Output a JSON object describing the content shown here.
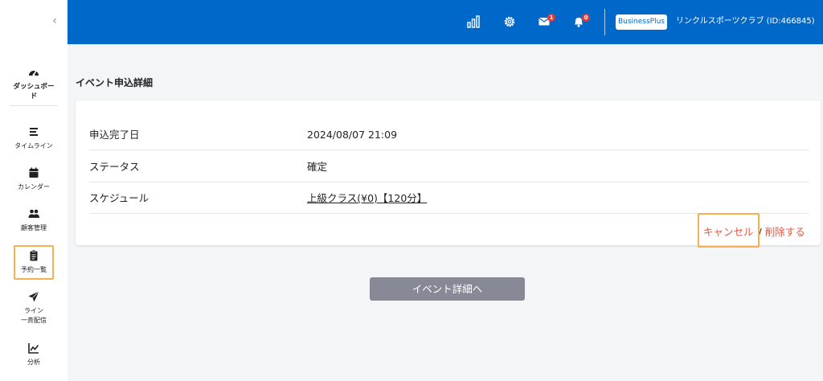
{
  "sidebar": {
    "items": [
      {
        "key": "dashboard",
        "label": "ダッシュボー\nド",
        "icon": "dashboard-gauge-icon"
      },
      {
        "key": "timeline",
        "label": "タイムライン",
        "icon": "timeline-lines-icon"
      },
      {
        "key": "calendar",
        "label": "カレンダー",
        "icon": "calendar-icon"
      },
      {
        "key": "customers",
        "label": "顧客管理",
        "icon": "users-icon"
      },
      {
        "key": "reservations",
        "label": "予約一覧",
        "icon": "clipboard-icon"
      },
      {
        "key": "line",
        "label": "ライン\n一斉配信",
        "icon": "paper-plane-icon"
      },
      {
        "key": "analytics",
        "label": "分析",
        "icon": "chart-line-icon"
      }
    ]
  },
  "header": {
    "mail_count": "1",
    "notification_count": "0",
    "plan": "BusinessPlus",
    "account": "リンクルスポーツクラブ (ID:466845)"
  },
  "main": {
    "title": "イベント申込詳細",
    "rows": [
      {
        "label": "申込完了日",
        "value": "2024/08/07 21:09"
      },
      {
        "label": "ステータス",
        "value": "確定"
      },
      {
        "label": "スケジュール",
        "value": "上級クラス(¥0)【120分】"
      }
    ],
    "cancel_label": "キャンセル",
    "separator": "/",
    "delete_label": "削除する",
    "detail_button": "イベント詳細へ"
  },
  "colors": {
    "header_bg": "#0068c9",
    "highlight": "#f6b04f",
    "danger_link": "#e8553e",
    "button_gray": "#878a96"
  }
}
